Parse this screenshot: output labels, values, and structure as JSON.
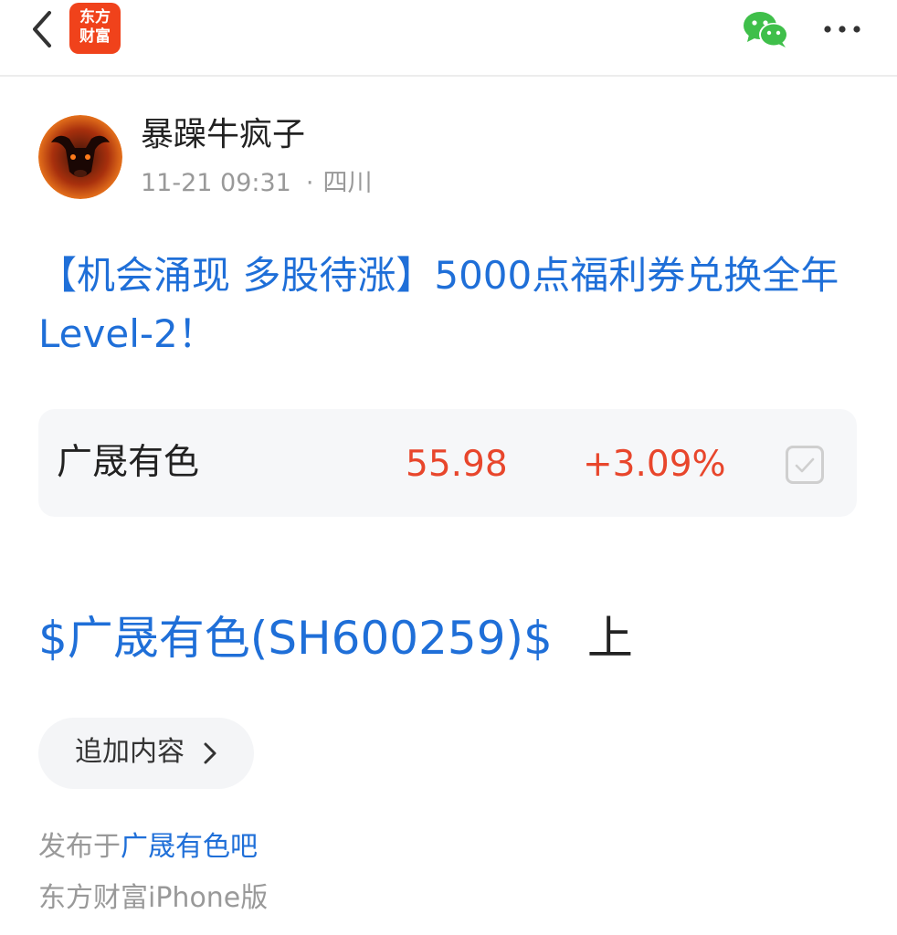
{
  "app": {
    "logo_line1": "东方",
    "logo_line2": "财富",
    "brand_color": "#f0421b",
    "link_color": "#1f6fd8",
    "up_color": "#e8462c"
  },
  "nav": {
    "back_icon": "chevron-left-icon",
    "share_icon": "wechat-icon",
    "more_icon": "more-dots-icon"
  },
  "author": {
    "name": "暴躁牛疯子",
    "time": "11-21 09:31",
    "location_separator": "·",
    "location": "四川"
  },
  "post": {
    "title": "【机会涌现 多股待涨】5000点福利券兑换全年Level-2！",
    "stock_link_text": "$广晟有色(SH600259)$",
    "body_text": "上"
  },
  "stock_card": {
    "name": "广晟有色",
    "price": "55.98",
    "change": "+3.09%",
    "check_icon": "checkbox-icon"
  },
  "actions": {
    "append_label": "追加内容",
    "append_icon": "chevron-right-icon"
  },
  "footer": {
    "published_prefix": "发布于",
    "forum_name": "广晟有色吧",
    "source": "东方财富iPhone版"
  }
}
